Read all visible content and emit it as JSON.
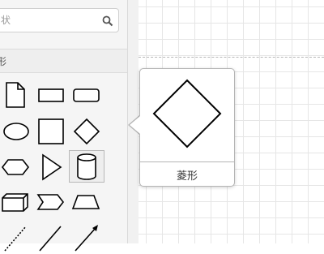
{
  "search": {
    "placeholder": "状"
  },
  "section": {
    "title": "形"
  },
  "shapes": [
    {
      "name": "note"
    },
    {
      "name": "rectangle"
    },
    {
      "name": "rounded-rectangle"
    },
    {
      "name": "ellipse"
    },
    {
      "name": "square"
    },
    {
      "name": "rhombus"
    },
    {
      "name": "hexagon"
    },
    {
      "name": "triangle"
    },
    {
      "name": "cylinder"
    },
    {
      "name": "cube"
    },
    {
      "name": "step"
    },
    {
      "name": "trapezoid"
    },
    {
      "name": "dotted-line"
    },
    {
      "name": "line"
    },
    {
      "name": "arrow"
    }
  ],
  "tooltip": {
    "label": "菱形"
  },
  "colors": {
    "stroke": "#000000",
    "sidebar": "#f5f5f5",
    "grid": "#e6e6e6"
  }
}
